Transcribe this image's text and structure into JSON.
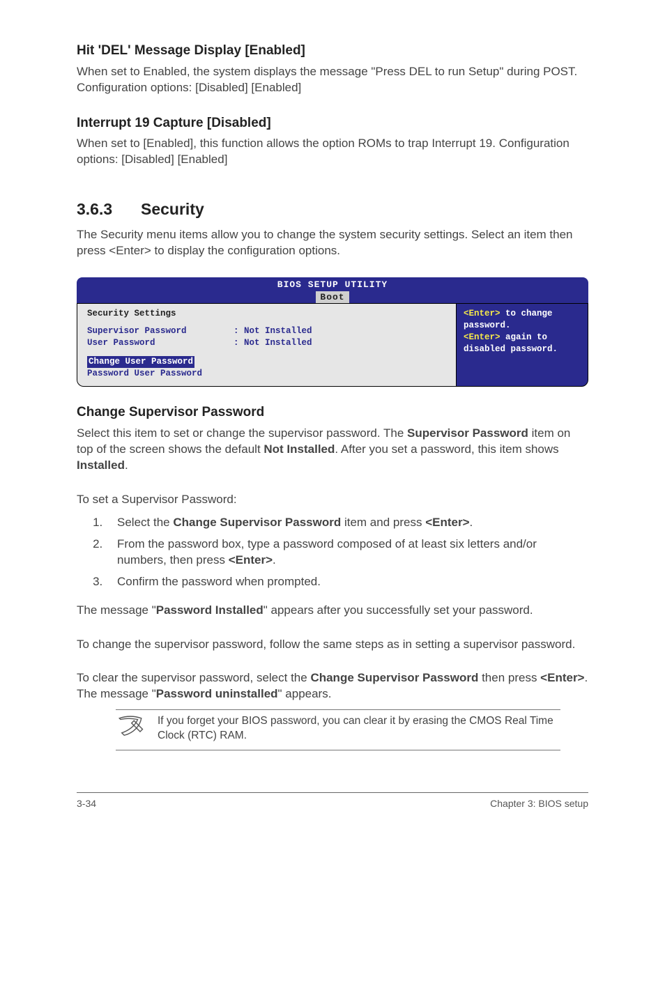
{
  "h1": {
    "title": "Hit 'DEL' Message Display [Enabled]"
  },
  "p1": "When set to Enabled, the system displays the message \"Press DEL to run Setup\" during POST. Configuration options: [Disabled] [Enabled]",
  "h2": {
    "title": "Interrupt 19 Capture [Disabled]"
  },
  "p2": "When set to [Enabled], this function allows the option ROMs to trap Interrupt 19. Configuration options: [Disabled] [Enabled]",
  "sec": {
    "num": "3.6.3",
    "title": "Security"
  },
  "p3": "The Security menu items allow you to change the system security settings. Select an item then press <Enter> to display the configuration options.",
  "bios": {
    "header": "BIOS SETUP UTILITY",
    "tab": "Boot",
    "panel_title": "Security Settings",
    "rows": [
      {
        "label": "Supervisor Password",
        "value": ": Not Installed"
      },
      {
        "label": "User Password",
        "value": ": Not Installed"
      }
    ],
    "selected": "Change User Password",
    "below_selected": "Password User Password",
    "help": {
      "l1a": "<Enter>",
      "l1b": " to change",
      "l2": "password.",
      "l3a": "<Enter>",
      "l3b": " again to",
      "l4": "disabled password."
    }
  },
  "h3": {
    "title": "Change Supervisor Password"
  },
  "p4_parts": {
    "a": "Select this item to set or change the supervisor password. The ",
    "b": "Supervisor Password",
    "c": " item on top of the screen shows the default ",
    "d": "Not Installed",
    "e": ". After you set a password, this item shows ",
    "f": "Installed",
    "g": "."
  },
  "p5": "To set a Supervisor Password:",
  "steps": {
    "s1a": "Select the ",
    "s1b": "Change Supervisor Password",
    "s1c": " item and press ",
    "s1d": "<Enter>",
    "s1e": ".",
    "s2a": "From the password box, type a password composed of at least six letters and/or numbers, then press ",
    "s2b": "<Enter>",
    "s2c": ".",
    "s3": "Confirm the password when prompted."
  },
  "p6_parts": {
    "a": "The message \"",
    "b": "Password Installed",
    "c": "\" appears after you successfully set your password."
  },
  "p7": "To change the supervisor password, follow the same steps as in setting a supervisor password.",
  "p8_parts": {
    "a": "To clear the supervisor password, select the ",
    "b": "Change Supervisor Password",
    "c": " then press ",
    "d": "<Enter>",
    "e": ". The message \"",
    "f": "Password uninstalled",
    "g": "\" appears."
  },
  "note": "If you forget your BIOS password, you can clear it by erasing the CMOS Real Time Clock (RTC) RAM.",
  "footer": {
    "left": "3-34",
    "right": "Chapter 3: BIOS setup"
  }
}
